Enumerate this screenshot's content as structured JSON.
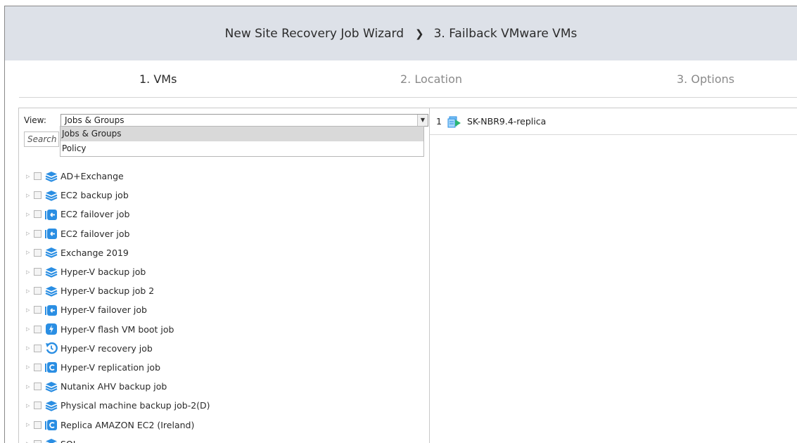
{
  "header": {
    "wizard_title": "New Site Recovery Job Wizard",
    "separator": "❯",
    "current_page": "3. Failback VMware VMs"
  },
  "steps": [
    {
      "label": "1. VMs",
      "active": true
    },
    {
      "label": "2. Location",
      "active": false
    },
    {
      "label": "3. Options",
      "active": false
    }
  ],
  "left_panel": {
    "view_label": "View:",
    "view_value": "Jobs & Groups",
    "search_placeholder": "Search",
    "dropdown_options": [
      "Jobs & Groups",
      "Policy"
    ],
    "tree_items": [
      {
        "label": "AD+Exchange",
        "icon": "backup-job-icon"
      },
      {
        "label": "EC2 backup job",
        "icon": "backup-job-icon"
      },
      {
        "label": "EC2 failover job",
        "icon": "failover-job-icon"
      },
      {
        "label": "EC2 failover job",
        "icon": "failover-job-icon"
      },
      {
        "label": "Exchange 2019",
        "icon": "backup-job-icon"
      },
      {
        "label": "Hyper-V backup job",
        "icon": "backup-job-icon"
      },
      {
        "label": "Hyper-V backup job 2",
        "icon": "backup-job-icon"
      },
      {
        "label": "Hyper-V failover job",
        "icon": "failover-job-icon"
      },
      {
        "label": "Hyper-V flash VM boot job",
        "icon": "flash-boot-job-icon"
      },
      {
        "label": "Hyper-V recovery job",
        "icon": "recovery-job-icon"
      },
      {
        "label": "Hyper-V replication job",
        "icon": "replication-job-icon"
      },
      {
        "label": "Nutanix AHV backup job",
        "icon": "backup-job-icon"
      },
      {
        "label": "Physical machine backup job-2(D)",
        "icon": "backup-job-icon"
      },
      {
        "label": "Replica AMAZON EC2 (Ireland)",
        "icon": "replication-job-icon"
      },
      {
        "label": "SQL",
        "icon": "backup-job-icon"
      }
    ]
  },
  "right_panel": {
    "selected": [
      {
        "num": "1",
        "label": "SK-NBR9.4-replica",
        "icon": "vm-replica-icon"
      }
    ]
  },
  "colors": {
    "header_bg": "#dde1e8",
    "icon_blue": "#2a8ee3",
    "replica_green": "#2bb673"
  }
}
